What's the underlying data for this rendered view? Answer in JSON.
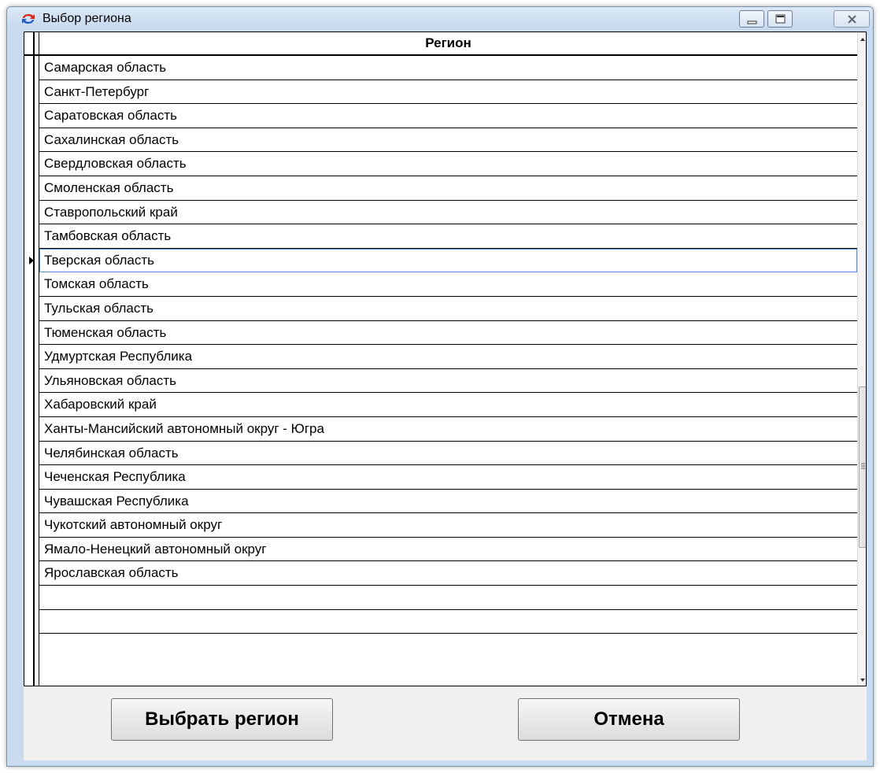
{
  "window": {
    "title": "Выбор региона",
    "icon": "app-refresh-icon"
  },
  "title_buttons": {
    "minimize": "minimize-icon",
    "maximize": "maximize-icon",
    "close": "close-icon"
  },
  "grid": {
    "column_header": "Регион",
    "rows": [
      "Самарская область",
      "Санкт-Петербург",
      "Саратовская область",
      "Сахалинская область",
      "Свердловская область",
      "Смоленская область",
      "Ставропольский край",
      "Тамбовская область",
      "Тверская область",
      "Томская область",
      "Тульская область",
      "Тюменская область",
      "Удмуртская Республика",
      "Ульяновская область",
      "Хабаровский край",
      "Ханты-Мансийский автономный округ - Югра",
      "Челябинская область",
      "Чеченская Республика",
      "Чувашская Республика",
      "Чукотский автономный округ",
      "Ямало-Ненецкий автономный округ",
      "Ярославская область",
      "",
      ""
    ],
    "selected_row": "Тверская область"
  },
  "buttons": {
    "select": "Выбрать регион",
    "cancel": "Отмена"
  },
  "colors": {
    "selection_outline": "#4a90e2",
    "window_frame": "#c9dbef"
  }
}
